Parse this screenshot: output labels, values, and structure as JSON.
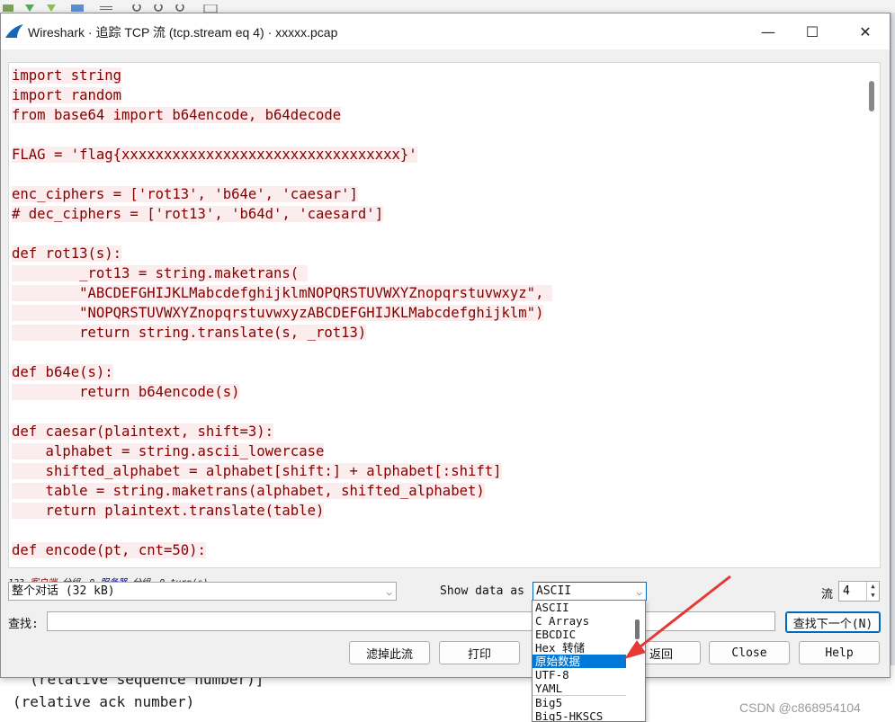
{
  "window": {
    "title": "Wireshark · 追踪 TCP 流 (tcp.stream eq 4) · xxxxx.pcap",
    "minimize": "—",
    "maximize": "☐",
    "close": "✕"
  },
  "stream_text": [
    "import string",
    "import random",
    "from base64 import b64encode, b64decode",
    "",
    "FLAG = 'flag{xxxxxxxxxxxxxxxxxxxxxxxxxxxxxxxxx}'",
    "",
    "enc_ciphers = ['rot13', 'b64e', 'caesar']",
    "# dec_ciphers = ['rot13', 'b64d', 'caesard']",
    "",
    "def rot13(s):",
    "        _rot13 = string.maketrans( ",
    "        \"ABCDEFGHIJKLMabcdefghijklmNOPQRSTUVWXYZnopqrstuvwxyz\", ",
    "        \"NOPQRSTUVWXYZnopqrstuvwxyzABCDEFGHIJKLMabcdefghijklm\")",
    "        return string.translate(s, _rot13)",
    "",
    "def b64e(s):",
    "        return b64encode(s)",
    "",
    "def caesar(plaintext, shift=3):",
    "    alphabet = string.ascii_lowercase",
    "    shifted_alphabet = alphabet[shift:] + alphabet[:shift]",
    "    table = string.maketrans(alphabet, shifted_alphabet)",
    "    return plaintext.translate(table)",
    "",
    "def encode(pt, cnt=50):"
  ],
  "status": {
    "prefix": "123 ",
    "client": "客户端",
    "mid1": " 分组，0 ",
    "server": "服务器",
    "mid2": " 分组，0 turn(s)."
  },
  "conversation_select": "整个对话 (32 kB)",
  "show_data_as": {
    "label": "Show data as",
    "selected": "ASCII",
    "options": [
      "ASCII",
      "C Arrays",
      "EBCDIC",
      "Hex 转储",
      "原始数据",
      "UTF-8",
      "YAML",
      "Big5",
      "Big5-HKSCS"
    ],
    "highlighted": "原始数据"
  },
  "stream": {
    "label": "流",
    "value": "4"
  },
  "find": {
    "label": "查找:",
    "value": "",
    "next_button": "查找下一个(N)"
  },
  "buttons": {
    "filter_out": "滤掉此流",
    "print": "打印",
    "back": "返回",
    "close": "Close",
    "help": "Help"
  },
  "background": {
    "line1": "  (relative sequence number)]",
    "line2": "(relative ack number)"
  },
  "watermark": "CSDN @c868954104",
  "colors": {
    "text_bg": "#fbeded",
    "text_fg": "#830000",
    "selection": "#0078d7",
    "arrow": "#e53935"
  }
}
